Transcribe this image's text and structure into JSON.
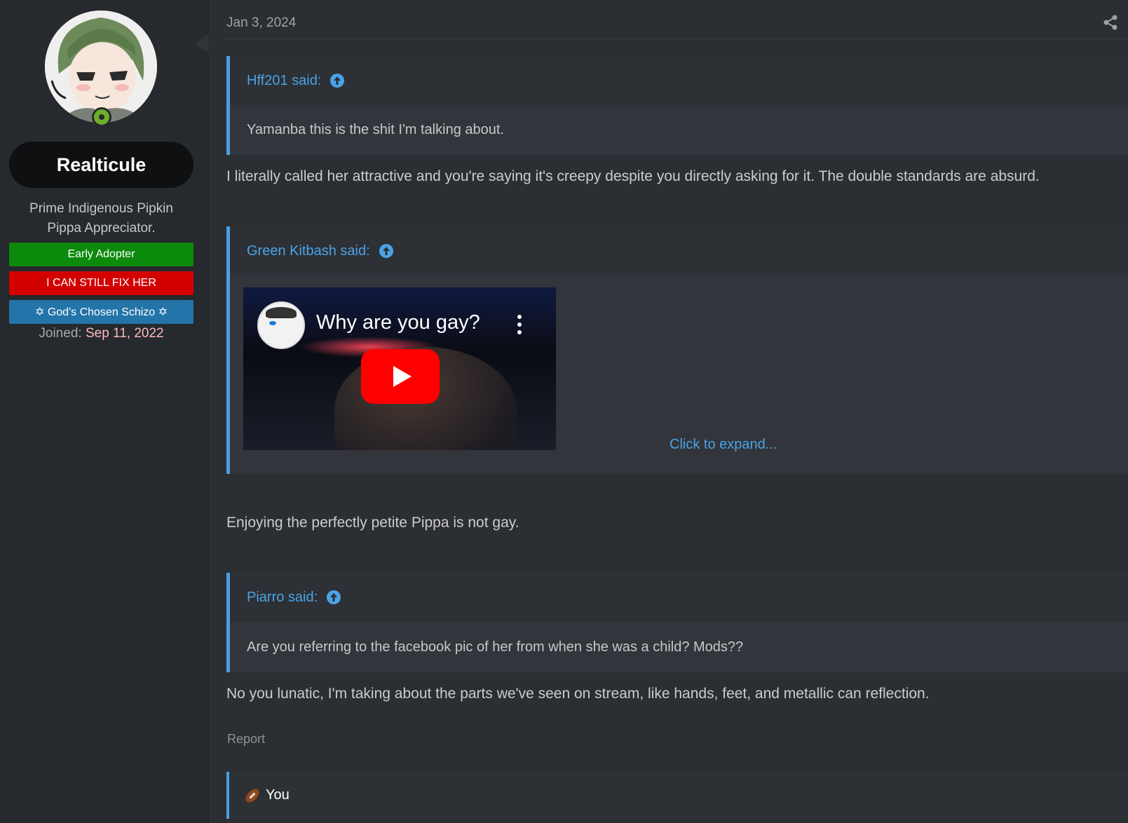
{
  "user": {
    "name": "Realticule",
    "title_line1": "Prime Indigenous Pipkin",
    "title_line2": "Pippa Appreciator.",
    "banners": [
      "Early Adopter",
      "I CAN STILL FIX HER",
      "✡ God's Chosen Schizo ✡"
    ],
    "joined_label": "Joined:",
    "joined_date": "Sep 11, 2022",
    "avatar_icon": "anime-avatar",
    "online_icon": "online-status-icon"
  },
  "post": {
    "date": "Jan 3, 2024",
    "share_icon": "share-icon",
    "quotes": [
      {
        "author": "Hff201 said:",
        "body": "Yamanba this is the shit I'm talking about."
      },
      {
        "author": "Green Kitbash said:",
        "video_title": "Why are you gay?",
        "expand": "Click to expand..."
      },
      {
        "author": "Piarro said:",
        "body": "Are you referring to the facebook pic of her from when she was a child? Mods??"
      }
    ],
    "replies": [
      "I literally called her attractive and you're saying it's creepy despite you directly asking for it. The double standards are absurd.",
      "Enjoying the perfectly petite Pippa is not gay.",
      "No you lunatic, I'm taking about the parts we've seen on stream, like hands, feet, and metallic can reflection."
    ],
    "report": "Report",
    "reaction_user": "You",
    "reaction_icon": "football-icon"
  },
  "colors": {
    "accent": "#4a9fe0",
    "early_adopter": "#0b8a0b",
    "fix_her": "#d30000",
    "schizo": "#2374a8",
    "joined_date": "#ffb8c4"
  }
}
